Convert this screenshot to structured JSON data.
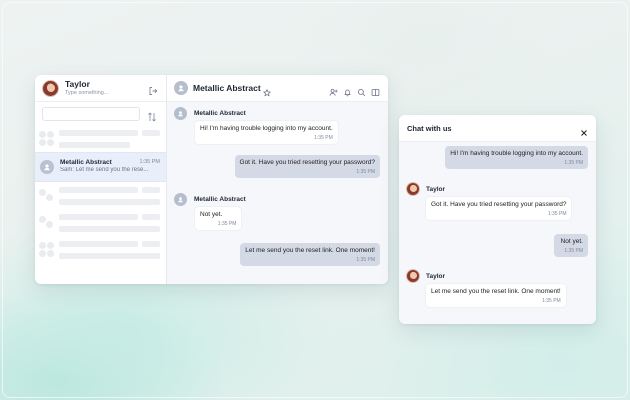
{
  "sidebar": {
    "user_name": "Taylor",
    "status_placeholder": "Type something...",
    "search_placeholder": "",
    "conversation": {
      "name": "Metallic Abstract",
      "time": "1:35 PM",
      "preview": "Sam: Let me send you the rese..."
    }
  },
  "chat": {
    "title": "Metallic Abstract",
    "messages": [
      {
        "sender": "Metallic Abstract",
        "text": "Hi! I'm having trouble logging into my account.",
        "time": "1:35 PM"
      },
      {
        "text": "Got it. Have you tried resetting your password?",
        "time": "1:35 PM"
      },
      {
        "sender": "Metallic Abstract",
        "text": "Not yet.",
        "time": "1:35 PM"
      },
      {
        "text": "Let me send you the reset link. One moment!",
        "time": "1:35 PM"
      }
    ]
  },
  "widget": {
    "title": "Chat with us",
    "messages": [
      {
        "text": "Hi! I'm having trouble logging into my account.",
        "time": "1:35 PM"
      },
      {
        "sender": "Taylor",
        "text": "Got it. Have you tried resetting your password?",
        "time": "1:35 PM"
      },
      {
        "text": "Not yet.",
        "time": "1:35 PM"
      },
      {
        "sender": "Taylor",
        "text": "Let me send you the reset link. One moment!",
        "time": "1:35 PM"
      }
    ]
  },
  "icons": {
    "logout": "logout-icon",
    "filter": "filter-icon",
    "star": "star-icon",
    "add_user": "add-user-icon",
    "bell": "bell-icon",
    "search": "search-icon",
    "panel": "panel-icon",
    "close": "close-icon"
  },
  "colors": {
    "selected_row": "#e9eefb",
    "outgoing_bubble": "#d4d9e6",
    "incoming_bubble": "#ffffff"
  }
}
